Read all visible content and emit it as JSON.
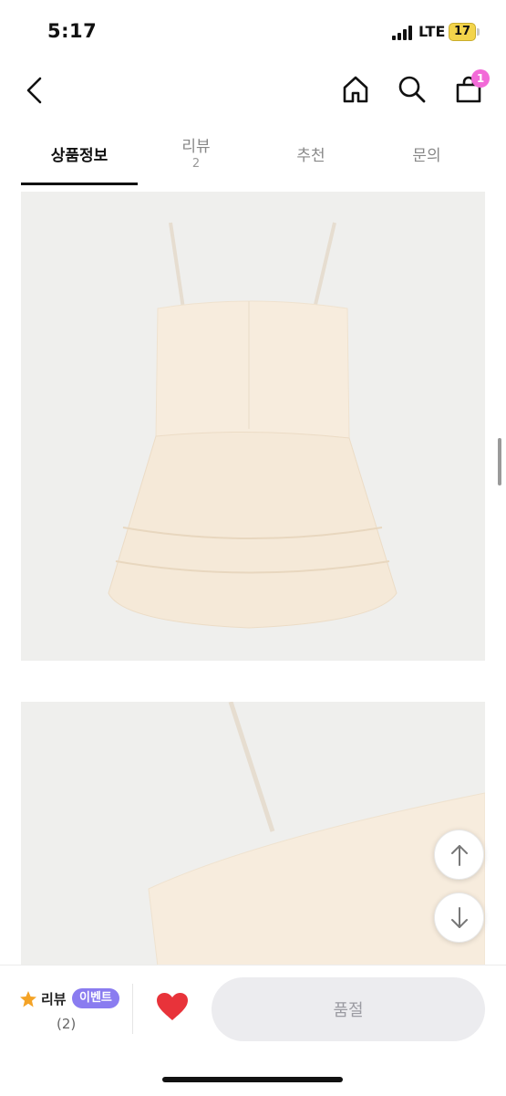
{
  "status_bar": {
    "time": "5:17",
    "network": "LTE",
    "battery": "17"
  },
  "header": {
    "back_icon": "chevron-left-icon",
    "home_icon": "home-icon",
    "search_icon": "search-icon",
    "cart_icon": "shopping-bag-icon",
    "cart_count": "1"
  },
  "tabs": [
    {
      "label": "상품정보",
      "sub": "",
      "active": true
    },
    {
      "label": "리뷰",
      "sub": "2",
      "active": false
    },
    {
      "label": "추천",
      "sub": "",
      "active": false
    },
    {
      "label": "문의",
      "sub": "",
      "active": false
    }
  ],
  "floating": {
    "up_icon": "arrow-up-icon",
    "down_icon": "arrow-down-icon"
  },
  "bottom_bar": {
    "review_label": "리뷰",
    "event_badge": "이벤트",
    "review_count": "(2)",
    "heart_icon": "heart-icon",
    "soldout_label": "품절"
  },
  "colors": {
    "accent_badge": "#f26bd8",
    "event_badge": "#8a7cf0",
    "heart": "#e8333a",
    "star": "#f4a326"
  }
}
